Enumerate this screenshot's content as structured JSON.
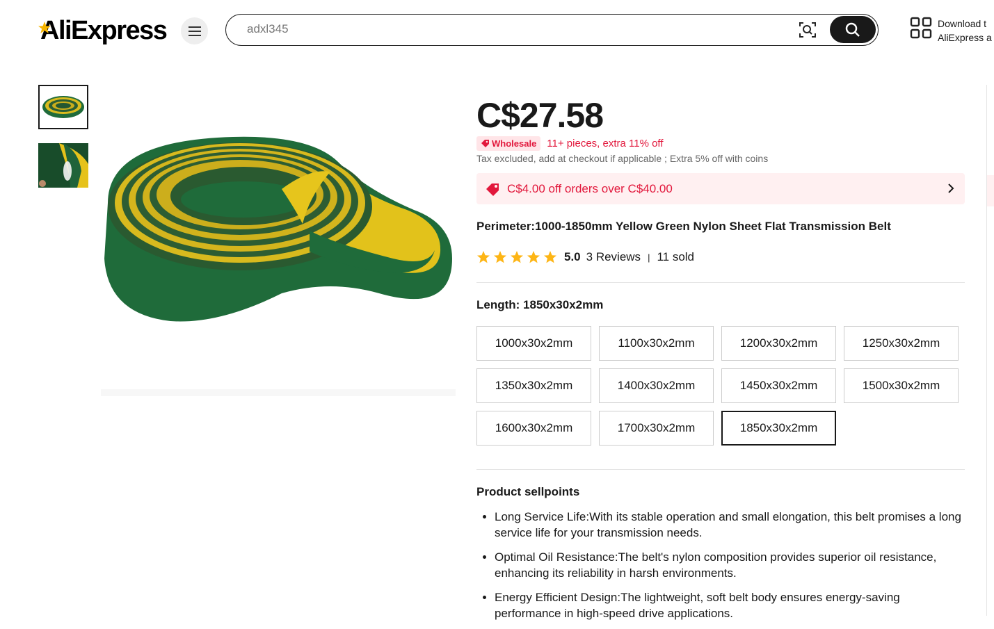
{
  "header": {
    "logo_text": "AliExpress",
    "search": {
      "value": "",
      "placeholder": "adxl345"
    },
    "download_line1": "Download t",
    "download_line2": "AliExpress a"
  },
  "product": {
    "price": "C$27.58",
    "wholesale_badge": "Wholesale",
    "wholesale_text": "11+ pieces, extra 11% off",
    "tax_text": "Tax excluded, add at checkout if applicable ; Extra 5% off with coins",
    "coupon_text": "C$4.00 off orders over C$40.00",
    "title": "Perimeter:1000-1850mm Yellow Green Nylon Sheet Flat Transmission Belt",
    "rating_value": "5.0",
    "rating_stars": 5,
    "reviews": "3 Reviews",
    "rating_separator": "|",
    "sold": "11 sold",
    "length_label": "Length: 1850x30x2mm",
    "sizes": [
      "1000x30x2mm",
      "1100x30x2mm",
      "1200x30x2mm",
      "1250x30x2mm",
      "1350x30x2mm",
      "1400x30x2mm",
      "1450x30x2mm",
      "1500x30x2mm",
      "1600x30x2mm",
      "1700x30x2mm",
      "1850x30x2mm"
    ],
    "selected_size": "1850x30x2mm",
    "sellpoints_title": "Product sellpoints",
    "sellpoints": [
      "Long Service Life:With its stable operation and small elongation, this belt promises a long service life for your transmission needs.",
      "Optimal Oil Resistance:The belt's nylon composition provides superior oil resistance, enhancing its reliability in harsh environments.",
      "Energy Efficient Design:The lightweight, soft belt body ensures energy-saving performance in high-speed drive applications."
    ]
  },
  "colors": {
    "accent_red": "#e2183c",
    "coupon_bg": "#fff0f1",
    "star_yellow": "#fdb515",
    "belt_green": "#1f6b3a",
    "belt_yellow": "#e2c21b"
  }
}
